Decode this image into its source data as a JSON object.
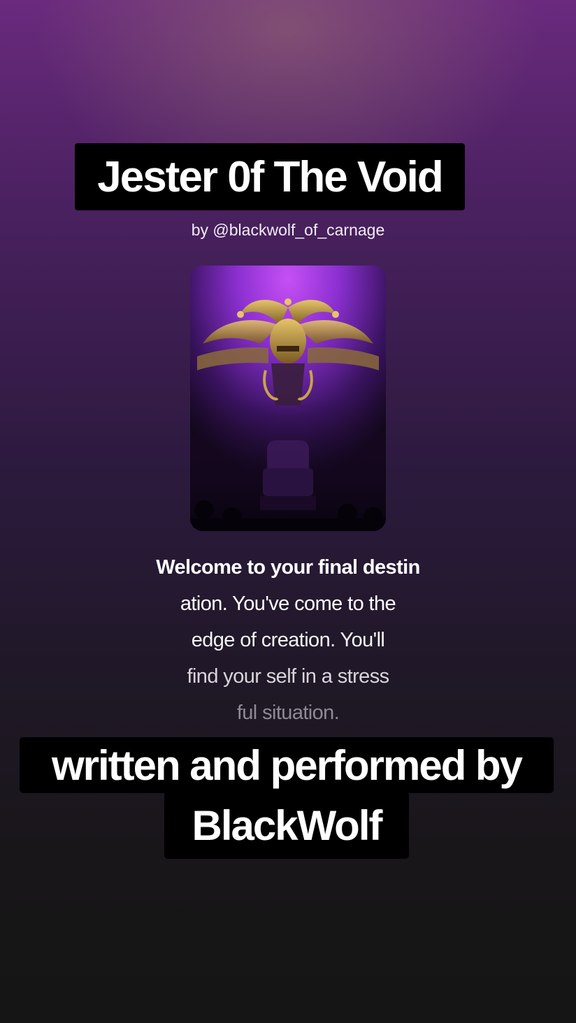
{
  "song": {
    "title": "Jester 0f The Void",
    "author": "by @blackwolf_of_carnage",
    "cover_art": "jester-throne-artwork"
  },
  "lyrics": {
    "lines": [
      "Welcome to your final destin",
      "ation. You've come to the",
      "edge of creation. You'll",
      "find your self in a stress",
      "ful situation."
    ]
  },
  "caption": {
    "line1": "written and performed by",
    "line2": "BlackWolf"
  },
  "colors": {
    "background_top": "#6a2a7e",
    "background_bottom": "#151515",
    "caption_box": "#000000",
    "cover_purple": "#8a2fd0",
    "jester_gold": "#c8a24a"
  }
}
